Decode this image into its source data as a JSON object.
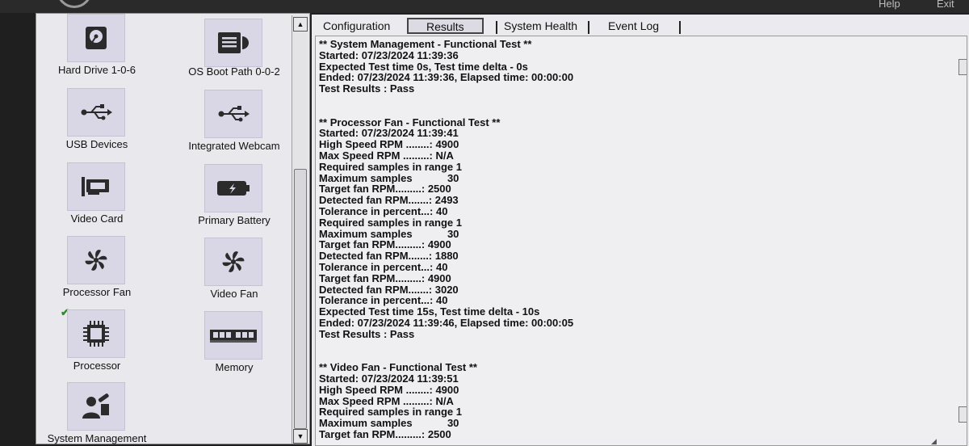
{
  "header": {
    "help_label": "Help",
    "exit_label": "Exit"
  },
  "devices": [
    {
      "label": "Hard Drive 1-0-6",
      "icon": "hard-drive-icon"
    },
    {
      "label": "OS Boot Path 0-0-2",
      "icon": "boot-path-icon"
    },
    {
      "label": "USB Devices",
      "icon": "usb-icon"
    },
    {
      "label": "Integrated Webcam",
      "icon": "usb-icon"
    },
    {
      "label": "Video Card",
      "icon": "video-card-icon"
    },
    {
      "label": "Primary Battery",
      "icon": "battery-icon"
    },
    {
      "label": "Processor Fan",
      "icon": "fan-icon"
    },
    {
      "label": "Video Fan",
      "icon": "fan-icon"
    },
    {
      "label": "Processor",
      "icon": "processor-chip-icon",
      "status": "✔"
    },
    {
      "label": "Memory",
      "icon": "memory-module-icon"
    },
    {
      "label": "System Management",
      "icon": "system-management-icon"
    }
  ],
  "tabs": [
    {
      "label": "Configuration",
      "active": false
    },
    {
      "label": "Results",
      "active": true
    },
    {
      "label": "System Health",
      "active": false
    },
    {
      "label": "Event Log",
      "active": false
    }
  ],
  "log_lines": [
    "** System Management - Functional Test **",
    "Started: 07/23/2024 11:39:36",
    "Expected Test time 0s, Test time delta - 0s",
    "Ended: 07/23/2024 11:39:36, Elapsed time: 00:00:00",
    "Test Results : Pass",
    "",
    "",
    "** Processor Fan - Functional Test **",
    "Started: 07/23/2024 11:39:41",
    "High Speed RPM ........: 4900",
    "Max Speed RPM .........: N/A",
    "Required samples in range 1",
    "Maximum samples            30",
    "Target fan RPM.........: 2500",
    "Detected fan RPM.......: 2493",
    "Tolerance in percent...: 40",
    "Required samples in range 1",
    "Maximum samples            30",
    "Target fan RPM.........: 4900",
    "Detected fan RPM.......: 1880",
    "Tolerance in percent...: 40",
    "Target fan RPM.........: 4900",
    "Detected fan RPM.......: 3020",
    "Tolerance in percent...: 40",
    "Expected Test time 15s, Test time delta - 10s",
    "Ended: 07/23/2024 11:39:46, Elapsed time: 00:00:05",
    "Test Results : Pass",
    "",
    "",
    "** Video Fan - Functional Test **",
    "Started: 07/23/2024 11:39:51",
    "High Speed RPM ........: 4900",
    "Max Speed RPM .........: N/A",
    "Required samples in range 1",
    "Maximum samples            30",
    "Target fan RPM.........: 2500"
  ]
}
